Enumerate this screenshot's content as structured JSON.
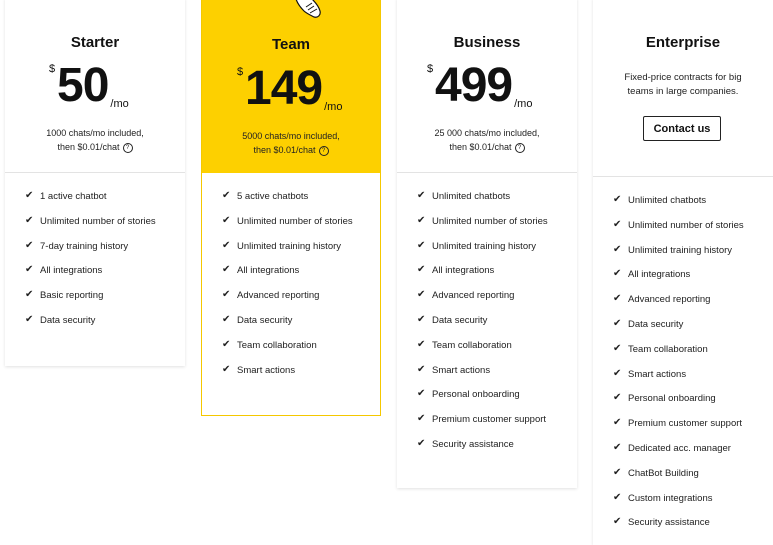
{
  "plans": {
    "starter": {
      "title": "Starter",
      "currency": "$",
      "amount": "50",
      "period": "/mo",
      "included_line1": "1000 chats/mo included,",
      "included_line2": "then $0.01/chat",
      "features": [
        "1 active chatbot",
        "Unlimited number of stories",
        "7-day training history",
        "All integrations",
        "Basic reporting",
        "Data security"
      ]
    },
    "team": {
      "title": "Team",
      "currency": "$",
      "amount": "149",
      "period": "/mo",
      "included_line1": "5000 chats/mo included,",
      "included_line2": "then $0.01/chat",
      "features": [
        "5 active chatbots",
        "Unlimited number of stories",
        "Unlimited training history",
        "All integrations",
        "Advanced reporting",
        "Data security",
        "Team collaboration",
        "Smart actions"
      ]
    },
    "business": {
      "title": "Business",
      "currency": "$",
      "amount": "499",
      "period": "/mo",
      "included_line1": "25 000 chats/mo included,",
      "included_line2": "then $0.01/chat",
      "features": [
        "Unlimited chatbots",
        "Unlimited number of stories",
        "Unlimited training history",
        "All integrations",
        "Advanced reporting",
        "Data security",
        "Team collaboration",
        "Smart actions",
        "Personal onboarding",
        "Premium customer support",
        "Security assistance"
      ]
    },
    "enterprise": {
      "title": "Enterprise",
      "desc_line1": "Fixed-price contracts for big",
      "desc_line2": "teams in large companies.",
      "cta": "Contact us",
      "features": [
        "Unlimited chatbots",
        "Unlimited number of stories",
        "Unlimited training history",
        "All integrations",
        "Advanced reporting",
        "Data security",
        "Team collaboration",
        "Smart actions",
        "Personal onboarding",
        "Premium customer support",
        "Dedicated acc. manager",
        "ChatBot Building",
        "Custom integrations",
        "Security assistance"
      ]
    }
  },
  "icons": {
    "check": "checkmark-icon",
    "help": "question-mark-icon",
    "hand": "pointing-hand-icon"
  },
  "colors": {
    "accent": "#fdd000"
  }
}
